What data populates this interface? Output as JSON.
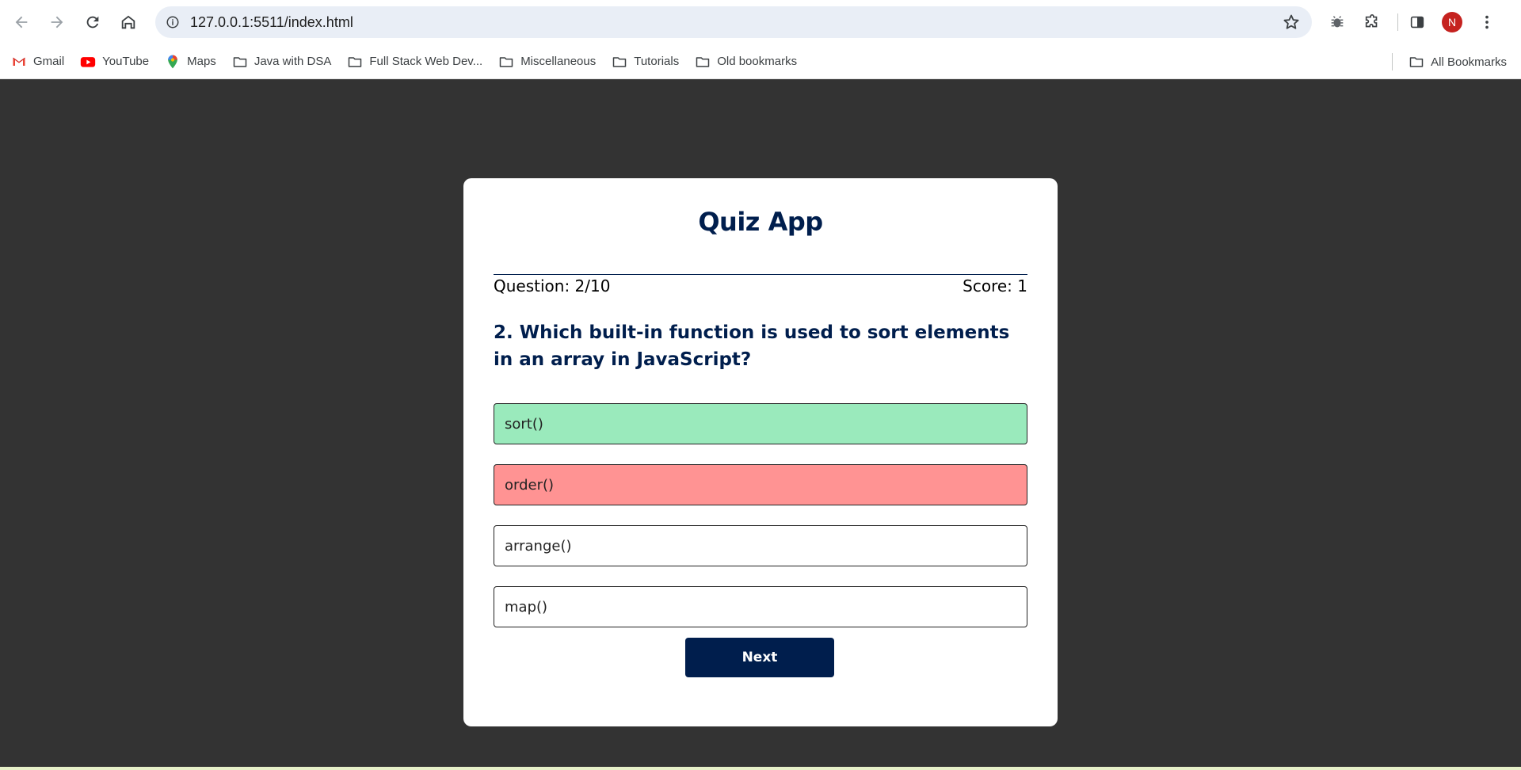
{
  "browser": {
    "url": "127.0.0.1:5511/index.html",
    "profile_initial": "N",
    "avatar_color": "#c5221f"
  },
  "bookmarks": {
    "items": [
      {
        "label": "Gmail",
        "icon": "gmail-icon"
      },
      {
        "label": "YouTube",
        "icon": "youtube-icon"
      },
      {
        "label": "Maps",
        "icon": "maps-icon"
      },
      {
        "label": "Java with DSA",
        "icon": "folder-icon"
      },
      {
        "label": "Full Stack Web Dev...",
        "icon": "folder-icon"
      },
      {
        "label": "Miscellaneous",
        "icon": "folder-icon"
      },
      {
        "label": "Tutorials",
        "icon": "folder-icon"
      },
      {
        "label": "Old bookmarks",
        "icon": "folder-icon"
      }
    ],
    "all_bookmarks": "All Bookmarks"
  },
  "quiz": {
    "title": "Quiz App",
    "question_counter": "Question: 2/10",
    "score": "Score: 1",
    "question": "2. Which built-in function is used to sort elements in an array in JavaScript?",
    "answers": [
      {
        "text": "sort()",
        "state": "correct"
      },
      {
        "text": "order()",
        "state": "incorrect"
      },
      {
        "text": "arrange()",
        "state": "neutral"
      },
      {
        "text": "map()",
        "state": "neutral"
      }
    ],
    "next_label": "Next"
  },
  "colors": {
    "page_background": "#333333",
    "primary": "#001e4d",
    "correct": "#9aeabc",
    "incorrect": "#ff9393"
  }
}
